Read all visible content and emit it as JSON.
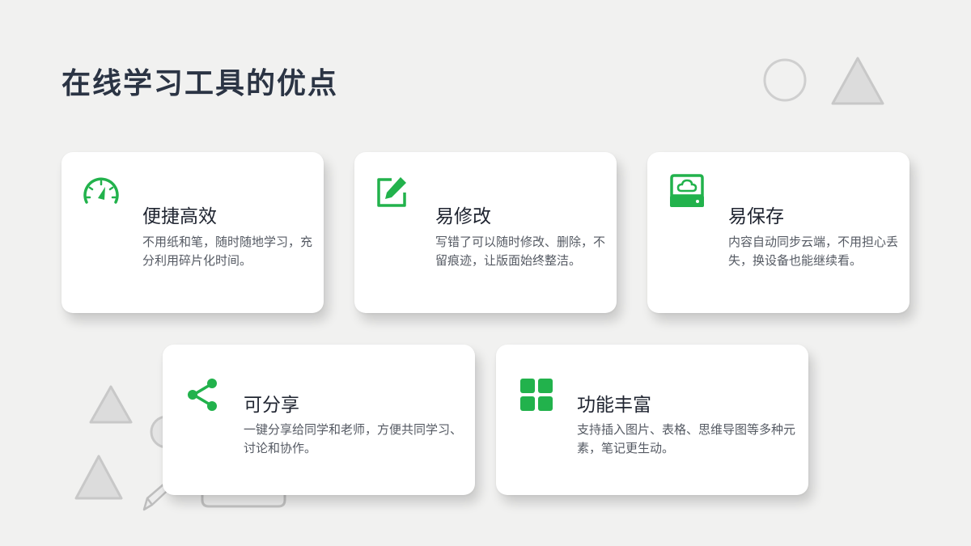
{
  "title": "在线学习工具的优点",
  "accent_color": "#22b24c",
  "cards": [
    {
      "icon": "speedometer-icon",
      "title": "便捷高效",
      "desc": "不用纸和笔，随时随地学习，充分利用碎片化时间。"
    },
    {
      "icon": "edit-icon",
      "title": "易修改",
      "desc": "写错了可以随时修改、删除，不留痕迹，让版面始终整洁。"
    },
    {
      "icon": "cloud-drive-icon",
      "title": "易保存",
      "desc": "内容自动同步云端，不用担心丢失，换设备也能继续看。"
    },
    {
      "icon": "share-icon",
      "title": "可分享",
      "desc": "一键分享给同学和老师，方便共同学习、讨论和协作。"
    },
    {
      "icon": "grid-icon",
      "title": "功能丰富",
      "desc": "支持插入图片、表格、思维导图等多种元素，笔记更生动。"
    }
  ]
}
